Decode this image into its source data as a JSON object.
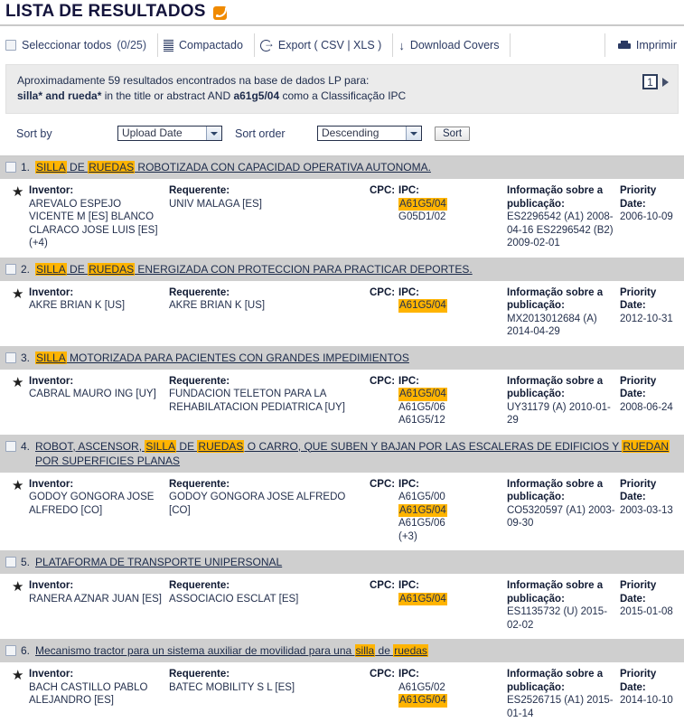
{
  "header": {
    "title": "LISTA DE RESULTADOS",
    "rss_icon": "rss-feed-icon"
  },
  "toolbar": {
    "select_all_label": "Seleccionar todos",
    "select_all_count": "(0/25)",
    "compact_label": "Compactado",
    "export_label": "Export ( CSV | XLS )",
    "download_covers_label": "Download Covers",
    "print_label": "Imprimir"
  },
  "summary": {
    "line1": "Aproximadamente 59 resultados encontrados na base de dados LP para:",
    "line2_pre": "",
    "line2_query1": "silla* and rueda*",
    "line2_mid": " in the title or abstract AND ",
    "line2_query2": "a61g5/04",
    "line2_post": " como a Classificação IPC",
    "page_number": "1"
  },
  "sort": {
    "sort_by_label": "Sort by",
    "sort_by_value": "Upload Date",
    "sort_order_label": "Sort order",
    "sort_order_value": "Descending",
    "sort_button": "Sort"
  },
  "columns": {
    "inventor": "Inventor:",
    "requerente": "Requerente:",
    "cpc": "CPC:",
    "ipc": "IPC:",
    "publication": "Informação sobre a publicação:",
    "priority": "Priority Date:"
  },
  "results": [
    {
      "num": "1.",
      "title_parts": [
        {
          "t": "SILLA",
          "hl": true
        },
        {
          "t": " DE ",
          "hl": false
        },
        {
          "t": "RUEDAS",
          "hl": true
        },
        {
          "t": " ROBOTIZADA CON CAPACIDAD OPERATIVA AUTONOMA.",
          "hl": false
        }
      ],
      "inventor": "AREVALO ESPEJO VICENTE M [ES] BLANCO CLARACO JOSE LUIS [ES] (+4)",
      "requerente": "UNIV MALAGA [ES]",
      "cpc": "",
      "ipc": [
        {
          "t": "A61G5/04",
          "hl": true
        },
        {
          "t": "G05D1/02",
          "hl": false
        }
      ],
      "publication": "ES2296542 (A1) 2008-04-16 ES2296542 (B2) 2009-02-01",
      "priority": "2006-10-09"
    },
    {
      "num": "2.",
      "title_parts": [
        {
          "t": "SILLA",
          "hl": true
        },
        {
          "t": " DE ",
          "hl": false
        },
        {
          "t": "RUEDAS",
          "hl": true
        },
        {
          "t": " ENERGIZADA CON PROTECCION PARA PRACTICAR DEPORTES.",
          "hl": false
        }
      ],
      "inventor": "AKRE BRIAN K [US]",
      "requerente": "AKRE BRIAN K [US]",
      "cpc": "",
      "ipc": [
        {
          "t": "A61G5/04",
          "hl": true
        }
      ],
      "publication": "MX2013012684 (A) 2014-04-29",
      "priority": "2012-10-31"
    },
    {
      "num": "3.",
      "title_parts": [
        {
          "t": "SILLA",
          "hl": true
        },
        {
          "t": " MOTORIZADA PARA PACIENTES CON GRANDES IMPEDIMIENTOS",
          "hl": false
        }
      ],
      "inventor": "CABRAL MAURO ING [UY]",
      "requerente": "FUNDACION TELETON PARA LA REHABILATACION PEDIATRICA [UY]",
      "cpc": "",
      "ipc": [
        {
          "t": "A61G5/04",
          "hl": true
        },
        {
          "t": "A61G5/06",
          "hl": false
        },
        {
          "t": "A61G5/12",
          "hl": false
        }
      ],
      "publication": "UY31179 (A) 2010-01-29",
      "priority": "2008-06-24"
    },
    {
      "num": "4.",
      "title_parts": [
        {
          "t": "ROBOT, ASCENSOR, ",
          "hl": false
        },
        {
          "t": "SILLA",
          "hl": true
        },
        {
          "t": " DE ",
          "hl": false
        },
        {
          "t": "RUEDAS",
          "hl": true
        },
        {
          "t": " O CARRO, QUE SUBEN Y BAJAN POR LAS ESCALERAS DE EDIFICIOS Y ",
          "hl": false
        },
        {
          "t": "RUEDAN",
          "hl": true
        },
        {
          "t": " POR SUPERFICIES PLANAS",
          "hl": false
        }
      ],
      "inventor": "GODOY GONGORA JOSE ALFREDO [CO]",
      "requerente": "GODOY GONGORA JOSE ALFREDO [CO]",
      "cpc": "",
      "ipc": [
        {
          "t": "A61G5/00",
          "hl": false
        },
        {
          "t": "A61G5/04",
          "hl": true
        },
        {
          "t": "A61G5/06",
          "hl": false
        },
        {
          "t": "(+3)",
          "hl": false
        }
      ],
      "publication": "CO5320597 (A1) 2003-09-30",
      "priority": "2003-03-13"
    },
    {
      "num": "5.",
      "title_parts": [
        {
          "t": "PLATAFORMA DE TRANSPORTE UNIPERSONAL",
          "hl": false
        }
      ],
      "inventor": "RANERA AZNAR JUAN [ES]",
      "requerente": "ASSOCIACIO ESCLAT [ES]",
      "cpc": "",
      "ipc": [
        {
          "t": "A61G5/04",
          "hl": true
        }
      ],
      "publication": "ES1135732 (U) 2015-02-02",
      "priority": "2015-01-08"
    },
    {
      "num": "6.",
      "title_parts": [
        {
          "t": "Mecanismo tractor para un sistema auxiliar de movilidad para una ",
          "hl": false
        },
        {
          "t": "silla",
          "hl": true
        },
        {
          "t": " de ",
          "hl": false
        },
        {
          "t": "ruedas",
          "hl": true
        }
      ],
      "inventor": "BACH CASTILLO PABLO ALEJANDRO [ES]",
      "requerente": "BATEC MOBILITY S L [ES]",
      "cpc": "",
      "ipc": [
        {
          "t": "A61G5/02",
          "hl": false
        },
        {
          "t": "A61G5/04",
          "hl": true
        }
      ],
      "publication": "ES2526715 (A1) 2015-01-14",
      "priority": "2014-10-10"
    }
  ],
  "colors": {
    "highlight": "#ffb400",
    "row_header_bg": "#cfcfcf",
    "summary_bg": "#ebebeb",
    "text": "#1b2a4a"
  }
}
